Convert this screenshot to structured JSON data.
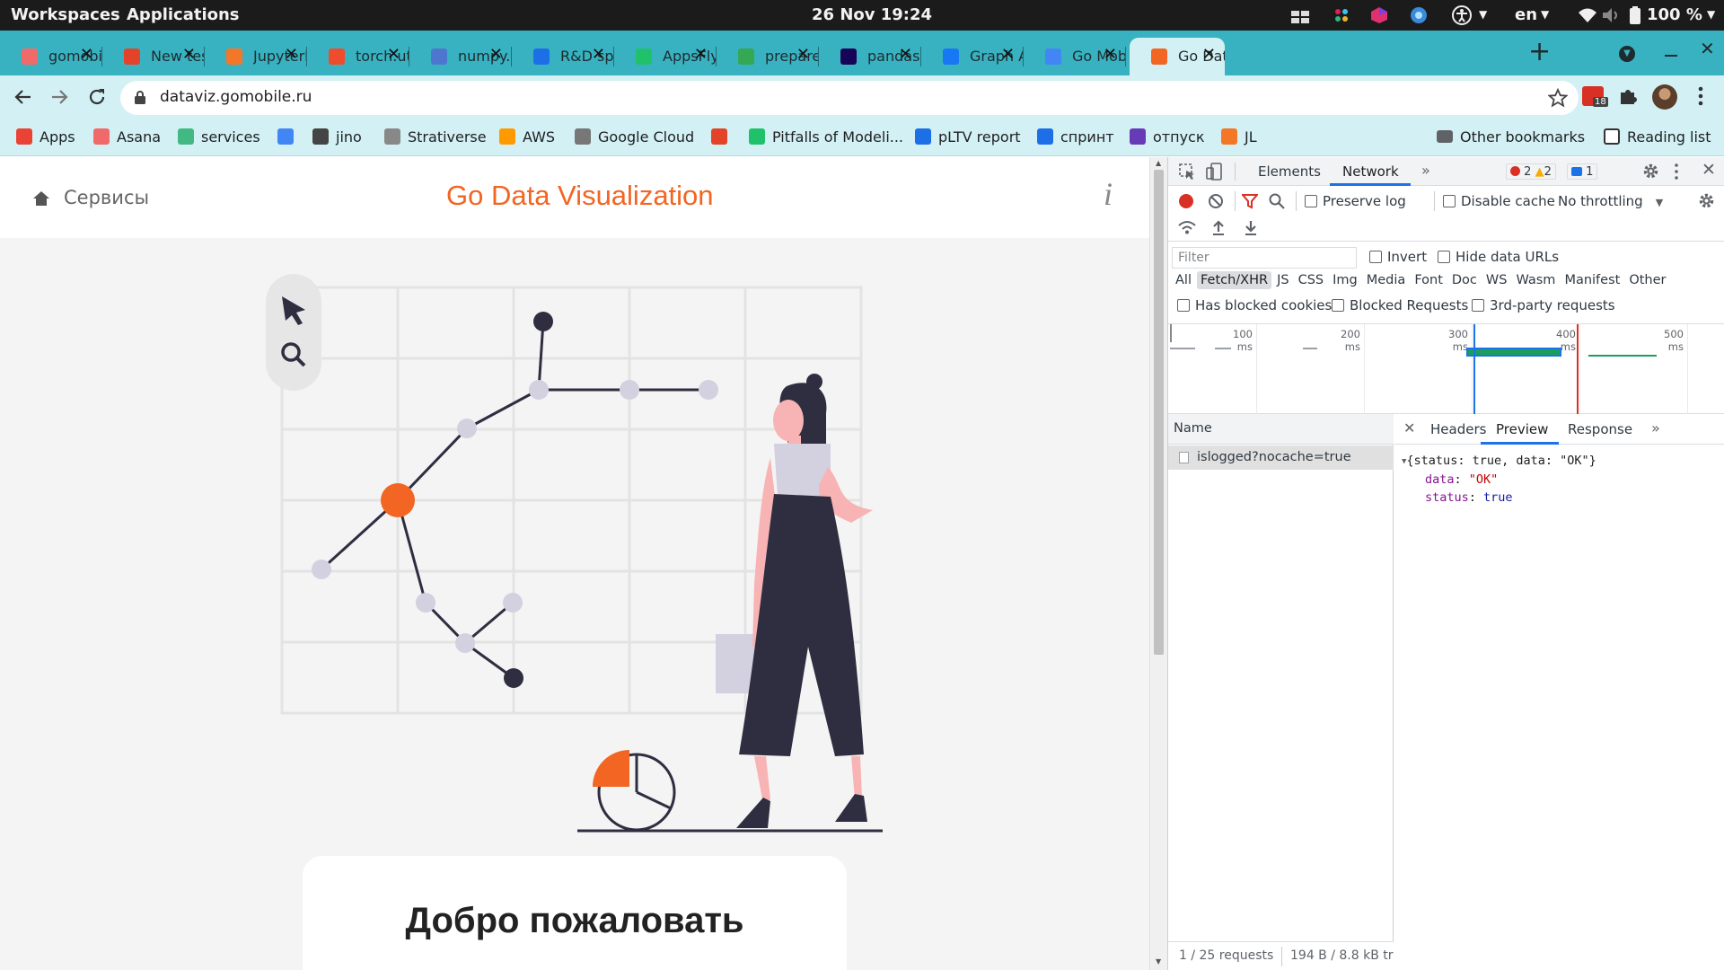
{
  "system": {
    "workspaces": "Workspaces",
    "applications": "Applications",
    "datetime": "26 Nov  19:24",
    "language": "en",
    "battery": "100 %"
  },
  "tabs": [
    {
      "title": "gomobil",
      "color": "#f06a6a"
    },
    {
      "title": "New tes",
      "color": "#e24329"
    },
    {
      "title": "Jupyterl",
      "color": "#f37726"
    },
    {
      "title": "torch.ut",
      "color": "#ee4c2c"
    },
    {
      "title": "numpy.a",
      "color": "#4d77cf"
    },
    {
      "title": "R&D spr",
      "color": "#1d6fe8"
    },
    {
      "title": "AppsFly",
      "color": "#1fc26b"
    },
    {
      "title": "prepare",
      "color": "#34a853"
    },
    {
      "title": "pandas.",
      "color": "#150458"
    },
    {
      "title": "Graph A",
      "color": "#1877f2"
    },
    {
      "title": "Go Mob",
      "color": "#4285f4"
    },
    {
      "title": "Go Data",
      "color": "#f26522"
    }
  ],
  "address": {
    "url": "dataviz.gomobile.ru",
    "extension_badge": "18"
  },
  "bookmarks": [
    {
      "label": "Apps",
      "color": "#ea4335",
      "icon": "apps-grid-icon"
    },
    {
      "label": "Asana",
      "color": "#f06a6a",
      "icon": "asana-icon"
    },
    {
      "label": "services",
      "color": "#42b883",
      "icon": "vue-icon"
    },
    {
      "label": "",
      "color": "#4285f4",
      "icon": "shield-icon"
    },
    {
      "label": "jino",
      "color": "#444444",
      "icon": "jino-icon"
    },
    {
      "label": "Strativerse",
      "color": "#888888",
      "icon": "strativerse-icon"
    },
    {
      "label": "AWS",
      "color": "#ff9900",
      "icon": "aws-icon"
    },
    {
      "label": "Google Cloud",
      "color": "#777777",
      "icon": "gear-icon"
    },
    {
      "label": "",
      "color": "#e24329",
      "icon": "gitlab-icon"
    },
    {
      "label": "Pitfalls of Modeli...",
      "color": "#1fc26b",
      "icon": "appsflyer-icon"
    },
    {
      "label": "pLTV report",
      "color": "#1d6fe8",
      "icon": "rnd-icon"
    },
    {
      "label": "спринт",
      "color": "#1d6fe8",
      "icon": "rnd-icon"
    },
    {
      "label": "отпуск",
      "color": "#673ab7",
      "icon": "form-icon"
    },
    {
      "label": "JL",
      "color": "#f37726",
      "icon": "jupyter-icon"
    }
  ],
  "bookmarks_right": {
    "other": "Other bookmarks",
    "reading": "Reading list"
  },
  "page": {
    "nav_label": "Сервисы",
    "title": "Go Data Visualization",
    "info_glyph": "i",
    "welcome": "Добро пожаловать"
  },
  "colors": {
    "accent": "#f26522",
    "dark": "#2f2e41",
    "node": "#d3d0e0",
    "teal": "#38b2c1"
  },
  "devtools": {
    "tabs": {
      "elements": "Elements",
      "network": "Network"
    },
    "errors": "2",
    "warnings": "2",
    "messages": "1",
    "preserve_log": "Preserve log",
    "disable_cache": "Disable cache",
    "throttling": "No throttling",
    "filter_placeholder": "Filter",
    "invert": "Invert",
    "hide_data_urls": "Hide data URLs",
    "types": [
      "All",
      "Fetch/XHR",
      "JS",
      "CSS",
      "Img",
      "Media",
      "Font",
      "Doc",
      "WS",
      "Wasm",
      "Manifest",
      "Other"
    ],
    "active_type": "Fetch/XHR",
    "blocked_cookies": "Has blocked cookies",
    "blocked_requests": "Blocked Requests",
    "third_party": "3rd-party requests",
    "timeline_ticks": [
      "100 ms",
      "200 ms",
      "300 ms",
      "400 ms",
      "500 ms"
    ],
    "name_header": "Name",
    "request": "islogged?nocache=true",
    "detail_tabs": {
      "headers": "Headers",
      "preview": "Preview",
      "response": "Response"
    },
    "preview": {
      "summary": "{status: true, data: \"OK\"}",
      "data_key": "data",
      "data_value": "\"OK\"",
      "status_key": "status",
      "status_value": "true"
    },
    "footer": {
      "requests": "1 / 25 requests",
      "size": "194 B / 8.8 kB tr"
    }
  }
}
